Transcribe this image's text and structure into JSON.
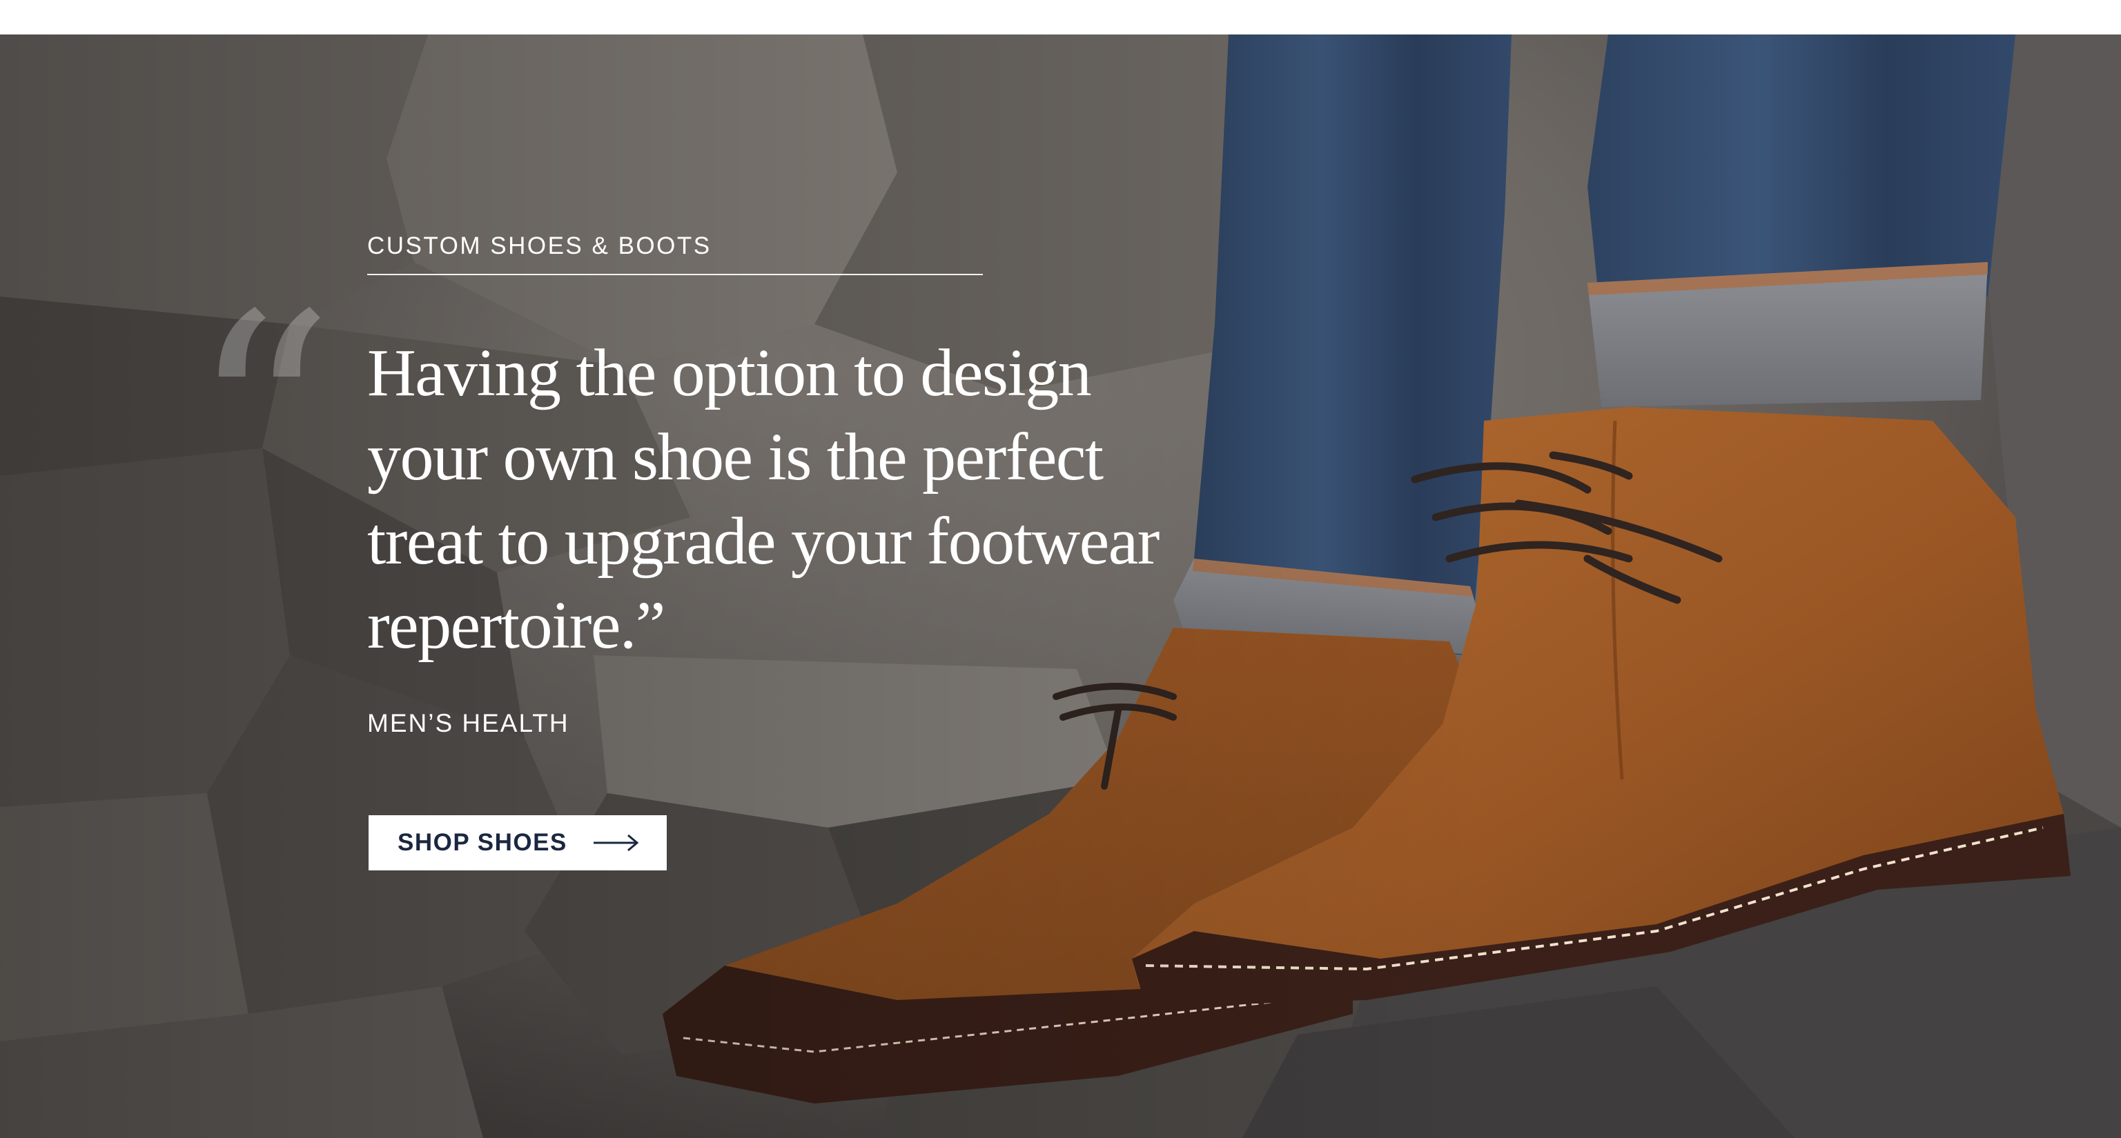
{
  "hero": {
    "eyebrow": "CUSTOM SHOES & BOOTS",
    "quote_mark": "“",
    "quote": "Having the option to design your own shoe is the perfect treat to upgrade your footwear repertoire.”",
    "attribution": "MEN’S HEALTH",
    "cta_label": "SHOP SHOES",
    "cta_icon": "arrow-right-icon",
    "background_image": "suede chukka boots with cuffed denim jeans standing on grey stone steps",
    "colors": {
      "text": "#ffffff",
      "cta_background": "#ffffff",
      "cta_text": "#1b2740"
    }
  }
}
